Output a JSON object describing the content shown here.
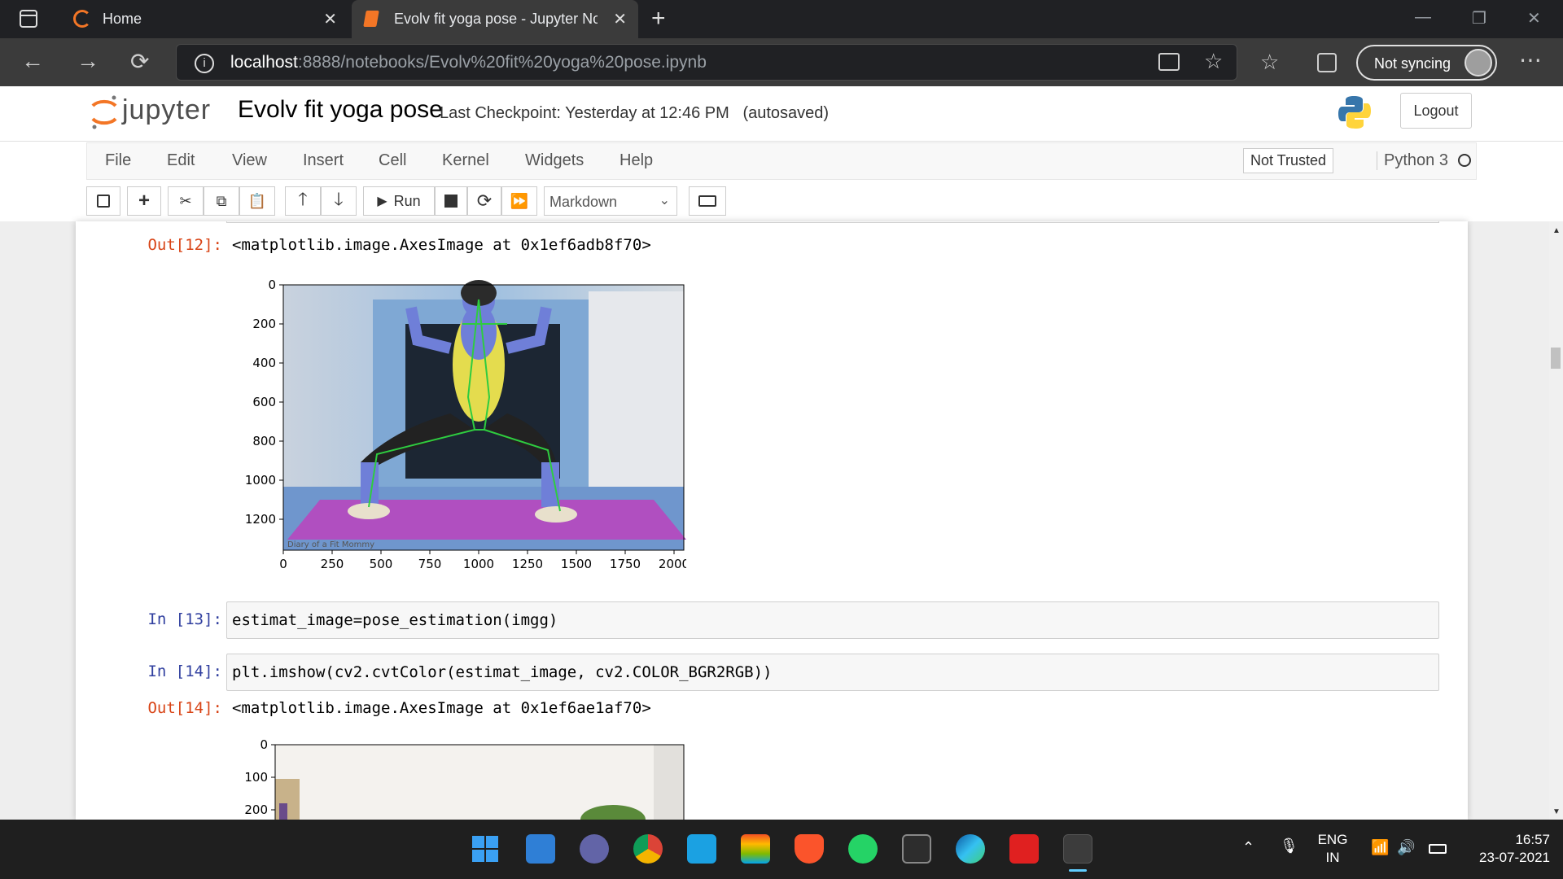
{
  "browser": {
    "tabs": [
      {
        "title": "Home",
        "active": false
      },
      {
        "title": "Evolv fit yoga pose - Jupyter Not",
        "active": true
      }
    ],
    "url_host": "localhost",
    "url_path": ":8888/notebooks/Evolv%20fit%20yoga%20pose.ipynb",
    "sync_label": "Not syncing"
  },
  "jupyter": {
    "logo_text": "jupyter",
    "notebook_name": "Evolv fit yoga pose",
    "checkpoint": "Last Checkpoint: Yesterday at 12:46 PM",
    "autosave": "(autosaved)",
    "logout_label": "Logout",
    "menu": [
      "File",
      "Edit",
      "View",
      "Insert",
      "Cell",
      "Kernel",
      "Widgets",
      "Help"
    ],
    "trust_label": "Not Trusted",
    "kernel_name": "Python 3",
    "run_label": "Run",
    "cell_type": "Markdown"
  },
  "cells": {
    "out12_prompt": "Out[12]:",
    "out12_text": "<matplotlib.image.AxesImage at 0x1ef6adb8f70>",
    "in13_prompt": "In [13]:",
    "in13_code": "estimat_image=pose_estimation(imgg)",
    "in14_prompt": "In [14]:",
    "in14_code": "plt.imshow(cv2.cvtColor(estimat_image, cv2.COLOR_BGR2RGB))",
    "out14_prompt": "Out[14]:",
    "out14_text": "<matplotlib.image.AxesImage at 0x1ef6ae1af70>"
  },
  "plot1": {
    "y_ticks": [
      "0",
      "200",
      "400",
      "600",
      "800",
      "1000",
      "1200"
    ],
    "x_ticks": [
      "0",
      "250",
      "500",
      "750",
      "1000",
      "1250",
      "1500",
      "1750",
      "2000"
    ],
    "watermark": "Diary of a Fit Mommy"
  },
  "plot2": {
    "y_ticks": [
      "0",
      "100",
      "200"
    ]
  },
  "taskbar": {
    "lang_top": "ENG",
    "lang_bottom": "IN",
    "time": "16:57",
    "date": "23-07-2021"
  }
}
